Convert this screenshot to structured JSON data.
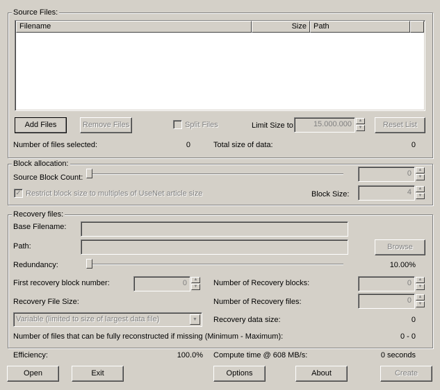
{
  "source_files": {
    "title": "Source Files:",
    "columns": [
      "Filename",
      "Size",
      "Path"
    ],
    "add_files": "Add Files",
    "remove_files": "Remove Files",
    "split_files": "Split Files",
    "limit_size_label": "Limit Size to:",
    "limit_size_value": "15.000.000",
    "reset_list": "Reset List",
    "files_selected_label": "Number of files selected:",
    "files_selected_value": "0",
    "total_size_label": "Total size of data:",
    "total_size_value": "0"
  },
  "block_allocation": {
    "title": "Block allocation:",
    "source_block_count_label": "Source Block Count:",
    "source_block_count_value": "0",
    "restrict_label": "Restrict block size to multiples of UseNet article size",
    "block_size_label": "Block Size:",
    "block_size_value": "4"
  },
  "recovery_files": {
    "title": "Recovery files:",
    "base_filename_label": "Base Filename:",
    "path_label": "Path:",
    "browse": "Browse",
    "redundancy_label": "Redundancy:",
    "redundancy_value": "10.00%",
    "first_block_label": "First recovery block number:",
    "first_block_value": "0",
    "num_blocks_label": "Number of Recovery blocks:",
    "num_blocks_value": "0",
    "file_size_label": "Recovery File Size:",
    "num_files_label": "Number of Recovery files:",
    "num_files_value": "0",
    "file_size_select": "Variable (limited to size of largest data file)",
    "data_size_label": "Recovery data size:",
    "data_size_value": "0",
    "reconstruct_label": "Number of files that can be fully reconstructed if missing (Minimum - Maximum):",
    "reconstruct_value": "0 - 0"
  },
  "status": {
    "efficiency_label": "Efficiency:",
    "efficiency_value": "100.0%",
    "compute_label": "Compute time @ 608 MB/s:",
    "compute_value": "0 seconds"
  },
  "buttons": {
    "open": "Open",
    "exit": "Exit",
    "options": "Options",
    "about": "About",
    "create": "Create"
  }
}
